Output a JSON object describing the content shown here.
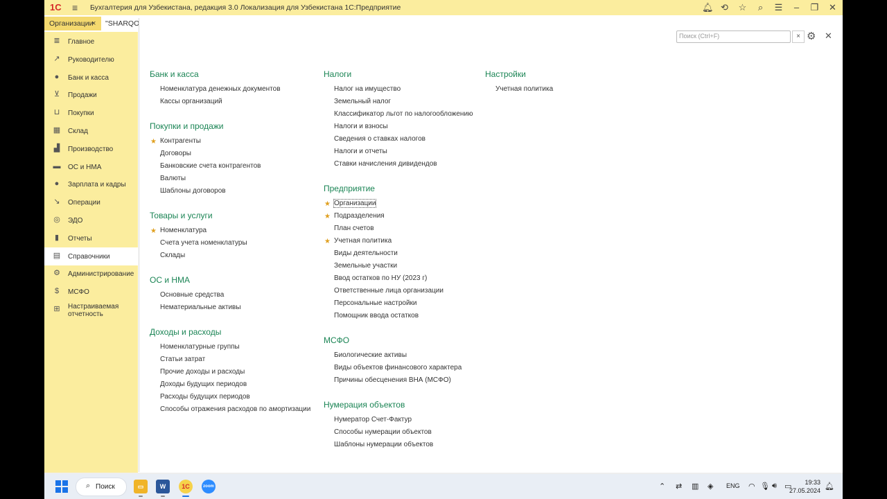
{
  "window": {
    "logo": "1С",
    "title": "Бухгалтерия для Узбекистана, редакция 3.0 Локализация для Узбекистана 1С:Предприятие"
  },
  "tabs": [
    {
      "label": "Организации",
      "close": "×"
    },
    {
      "label": "\"SHARQON"
    }
  ],
  "sidebar": {
    "items": [
      {
        "label": "Главное",
        "icon": "menu-lines-icon"
      },
      {
        "label": "Руководителю",
        "icon": "trend-icon"
      },
      {
        "label": "Банк и касса",
        "icon": "coin-icon"
      },
      {
        "label": "Продажи",
        "icon": "cart-icon"
      },
      {
        "label": "Покупки",
        "icon": "basket-icon"
      },
      {
        "label": "Склад",
        "icon": "warehouse-icon"
      },
      {
        "label": "Производство",
        "icon": "factory-icon"
      },
      {
        "label": "ОС и НМА",
        "icon": "truck-icon"
      },
      {
        "label": "Зарплата и кадры",
        "icon": "person-icon"
      },
      {
        "label": "Операции",
        "icon": "dt-kt-icon"
      },
      {
        "label": "ЭДО",
        "icon": "edo-icon"
      },
      {
        "label": "Отчеты",
        "icon": "chart-icon"
      },
      {
        "label": "Справочники",
        "icon": "book-icon"
      },
      {
        "label": "Администрирование",
        "icon": "gear-icon"
      },
      {
        "label": "МСФО",
        "icon": "dollar-icon"
      },
      {
        "label": "Настраиваемая",
        "label2": "отчетность",
        "icon": "report-icon"
      }
    ],
    "active_index": 12
  },
  "search": {
    "placeholder": "Поиск (Ctrl+F)",
    "clear": "×"
  },
  "columns": {
    "col1": [
      {
        "title": "Банк и касса",
        "items": [
          {
            "label": "Номенклатура денежных документов"
          },
          {
            "label": "Кассы организаций"
          }
        ]
      },
      {
        "title": "Покупки и продажи",
        "items": [
          {
            "label": "Контрагенты",
            "star": true
          },
          {
            "label": "Договоры"
          },
          {
            "label": "Банковские счета контрагентов"
          },
          {
            "label": "Валюты"
          },
          {
            "label": "Шаблоны договоров"
          }
        ]
      },
      {
        "title": "Товары и услуги",
        "items": [
          {
            "label": "Номенклатура",
            "star": true
          },
          {
            "label": "Счета учета номенклатуры"
          },
          {
            "label": "Склады"
          }
        ]
      },
      {
        "title": "ОС и НМА",
        "items": [
          {
            "label": "Основные средства"
          },
          {
            "label": "Нематериальные активы"
          }
        ]
      },
      {
        "title": "Доходы и расходы",
        "items": [
          {
            "label": "Номенклатурные группы"
          },
          {
            "label": "Статьи затрат"
          },
          {
            "label": "Прочие доходы и расходы"
          },
          {
            "label": "Доходы будущих периодов"
          },
          {
            "label": "Расходы будущих периодов"
          },
          {
            "label": "Способы отражения расходов по амортизации"
          }
        ]
      }
    ],
    "col2": [
      {
        "title": "Налоги",
        "items": [
          {
            "label": "Налог на имущество"
          },
          {
            "label": "Земельный налог"
          },
          {
            "label": "Классификатор льгот по налогообложению"
          },
          {
            "label": "Налоги и взносы"
          },
          {
            "label": "Сведения о ставках налогов"
          },
          {
            "label": "Налоги и отчеты"
          },
          {
            "label": "Ставки начисления дивидендов"
          }
        ]
      },
      {
        "title": "Предприятие",
        "items": [
          {
            "label": "Организации",
            "star": true,
            "focused": true
          },
          {
            "label": "Подразделения",
            "star": true
          },
          {
            "label": "План счетов"
          },
          {
            "label": "Учетная политика",
            "star": true
          },
          {
            "label": "Виды деятельности"
          },
          {
            "label": "Земельные участки"
          },
          {
            "label": "Ввод остатков по НУ (2023 г)"
          },
          {
            "label": "Ответственные лица организации"
          },
          {
            "label": "Персональные настройки"
          },
          {
            "label": "Помощник ввода остатков"
          }
        ]
      },
      {
        "title": "МСФО",
        "items": [
          {
            "label": "Биологические активы"
          },
          {
            "label": "Виды объектов финансового характера"
          },
          {
            "label": "Причины обесценения ВНА (МСФО)"
          }
        ]
      },
      {
        "title": "Нумерация объектов",
        "items": [
          {
            "label": "Нумератор Счет-Фактур"
          },
          {
            "label": "Способы нумерации объектов"
          },
          {
            "label": "Шаблоны нумерации объектов"
          }
        ]
      }
    ],
    "col3": [
      {
        "title": "Настройки",
        "items": [
          {
            "label": "Учетная политика"
          }
        ]
      }
    ]
  },
  "taskbar": {
    "search_label": "Поиск",
    "lang": "ENG",
    "time": "19:33",
    "date": "27.05.2024"
  },
  "colors": {
    "accent_green": "#1a8454",
    "panel_yellow": "#FBED9E",
    "star": "#e0a020"
  }
}
